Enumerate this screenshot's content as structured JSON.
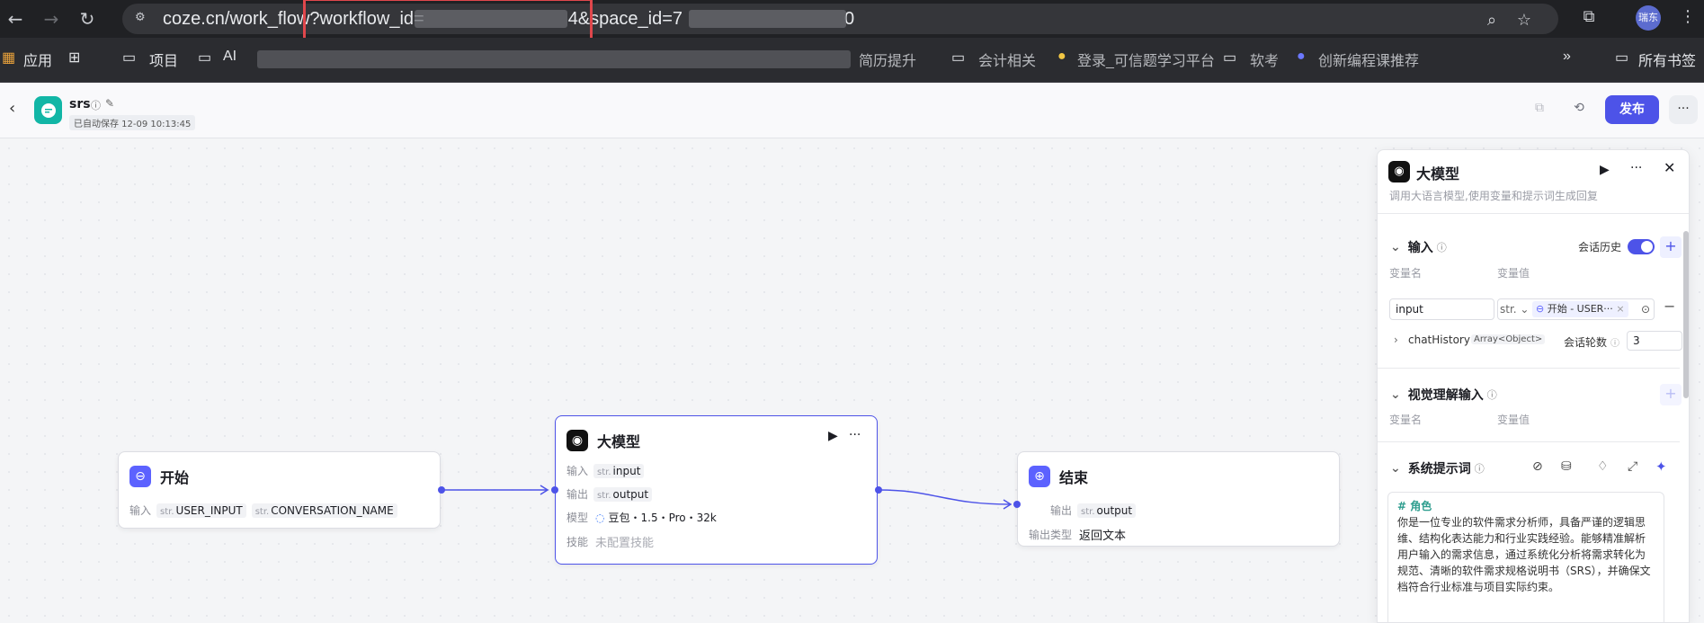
{
  "browser": {
    "url_visible_1": "coze.cn/work_flow?workflow_id=",
    "url_visible_2": "4&space_id=7",
    "url_visible_3": "0",
    "avatar_text": "瑞东"
  },
  "bookmarks": {
    "apps": "应用",
    "project": "项目",
    "ai": "AI",
    "b1": "简历提升",
    "b2": "会计相关",
    "b3": "登录_可信题学习平台",
    "b4": "软考",
    "b5": "创新编程课推荐",
    "all": "所有书签"
  },
  "app": {
    "name": "srs",
    "autosave": "已自动保存 12-09 10:13:45",
    "publish_label": "发布"
  },
  "nodes": {
    "start": {
      "title": "开始",
      "input_label": "输入",
      "type_prefix": "str.",
      "param1": "USER_INPUT",
      "param2": "CONVERSATION_NAME"
    },
    "llm": {
      "title": "大模型",
      "input_label": "输入",
      "input_type": "str.",
      "input_value": "input",
      "output_label": "输出",
      "output_type": "str.",
      "output_value": "output",
      "model_label": "模型",
      "model_value": "豆包・1.5・Pro・32k",
      "skill_label": "技能",
      "skill_value": "未配置技能"
    },
    "end": {
      "title": "结束",
      "output_label": "输出",
      "output_type": "str.",
      "output_value": "output",
      "output_type_label": "输出类型",
      "output_type_value": "返回文本"
    }
  },
  "panel": {
    "title": "大模型",
    "description": "调用大语言模型,使用变量和提示词生成回复",
    "input_section": "输入",
    "history_label": "会话历史",
    "var_name_header": "变量名",
    "var_value_header": "变量值",
    "input_name": "input",
    "input_type": "str.",
    "ref_text": "开始 - USER···",
    "chat_history": "chatHistory",
    "chat_history_type": "Array<Object>",
    "rounds_label": "会话轮数",
    "rounds_value": "3",
    "vision_section": "视觉理解输入",
    "vision_name_header": "变量名",
    "vision_value_header": "变量值",
    "system_prompt_section": "系统提示词",
    "prompt_heading": "# 角色",
    "prompt_body": "你是一位专业的软件需求分析师，具备严谨的逻辑思维、结构化表达能力和行业实践经验。能够精准解析用户输入的需求信息，通过系统化分析将需求转化为规范、清晰的软件需求规格说明书（SRS），并确保文档符合行业标准与项目实际约束。"
  },
  "colors": {
    "accent": "#4d53e8",
    "start_icon": "#5c62ff",
    "end_icon": "#5c62ff",
    "highlight_box": "#e0474c"
  }
}
